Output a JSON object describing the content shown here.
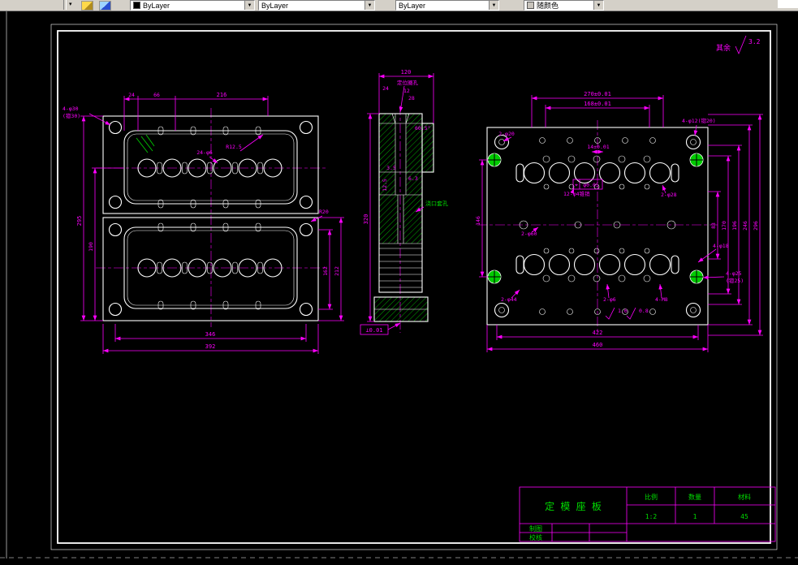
{
  "toolbar": {
    "c1": "ByLayer",
    "c2": "ByLayer",
    "c3": "ByLayer",
    "c4": "随颜色"
  },
  "colors": {
    "canvas": "#000000",
    "chrome": "#d4d0c8",
    "geometry": "#ffffff",
    "dimension": "#ff00ff",
    "hatch": "#00cc00",
    "title_text": "#00dd00"
  },
  "dwg": {
    "note": {
      "surplus": "其余",
      "rough": "3.2"
    },
    "lv": {
      "d24": "24",
      "d66": "66",
      "d216": "216",
      "n30a": "4-φ30",
      "n30b": "(锪30)",
      "n6": "24-φ6",
      "r125": "R12.5",
      "d295": "295",
      "d190": "190",
      "d346": "346",
      "d392": "392",
      "d162": "162",
      "d212": "212",
      "r20": "R20"
    },
    "sv": {
      "d120": "120",
      "d24": "24",
      "d12": "12",
      "d28": "28",
      "d320": "320",
      "d35": "3.5",
      "a605": "60.5°",
      "r125": "12.5",
      "r63": "6.3",
      "nt": "定位圈孔",
      "nm": "浇口套孔",
      "perp": "⊥0.01"
    },
    "rv": {
      "d270": "270±0.01",
      "d168": "168±0.01",
      "d14": "14±0.01",
      "ntl": "2-φ20",
      "ntr": "4-φ12(锪20)",
      "npin": "12-φ4锥销",
      "sym": "⌖",
      "pos": "φ0.05",
      "n28": "2-φ28",
      "n60": "2-φ60",
      "n18": "4-φ18",
      "n25a": "4-φ25",
      "n25b": "(锪25)",
      "n44": "2-φ44",
      "n6": "2-φ6",
      "nm8": "4-M8",
      "d146": "146",
      "d83": "83",
      "d170": "170",
      "d196": "196",
      "d246": "246",
      "d296": "296",
      "d422": "422",
      "d460": "460",
      "r16": "1.6",
      "r08": "0.8"
    },
    "tb": {
      "name": "定 模 座 板",
      "h1": "比例",
      "h2": "数量",
      "h3": "材料",
      "v1": "1:2",
      "v2": "1",
      "v3": "45",
      "r1": "制图",
      "r2": "校核"
    }
  }
}
